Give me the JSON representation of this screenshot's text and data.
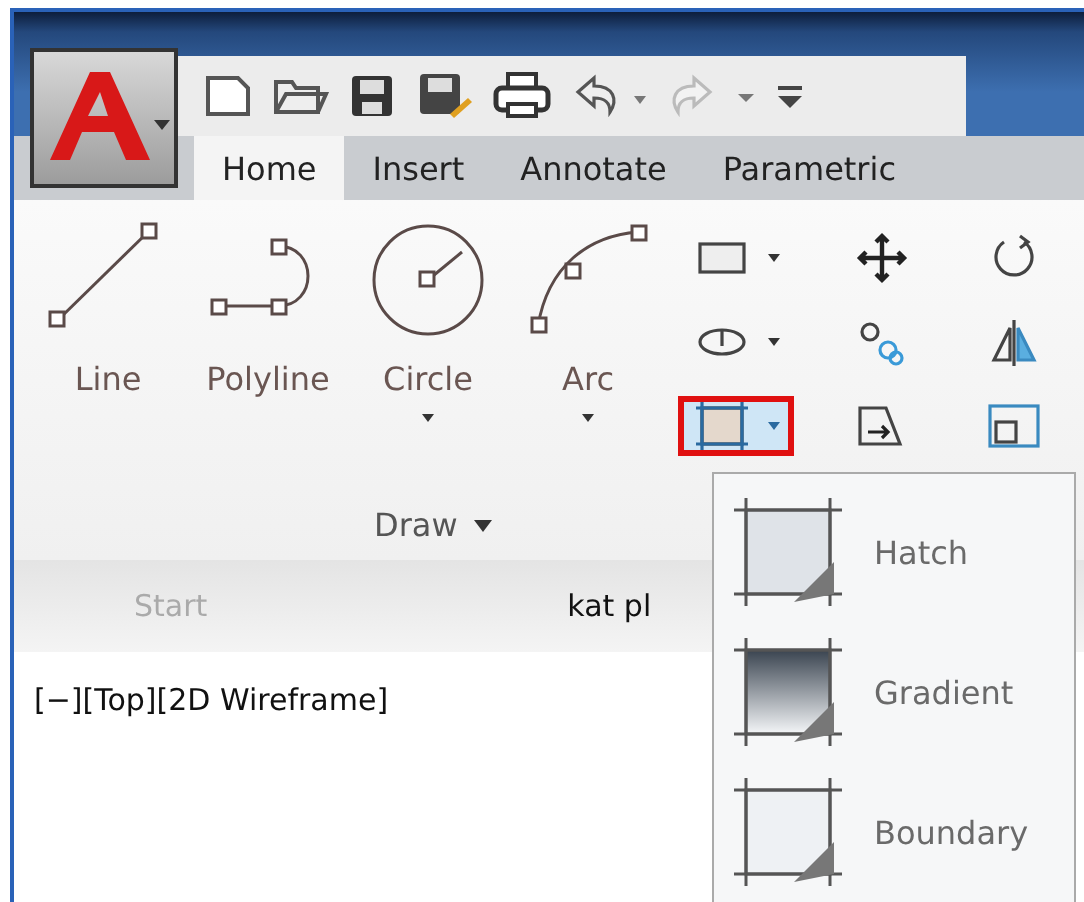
{
  "tabs": [
    {
      "label": "Home",
      "selected": true
    },
    {
      "label": "Insert",
      "selected": false
    },
    {
      "label": "Annotate",
      "selected": false
    },
    {
      "label": "Parametric",
      "selected": false
    }
  ],
  "draw_tools": [
    {
      "kind": "line",
      "label": "Line",
      "dropdown": false
    },
    {
      "kind": "polyline",
      "label": "Polyline",
      "dropdown": false
    },
    {
      "kind": "circle",
      "label": "Circle",
      "dropdown": true
    },
    {
      "kind": "arc",
      "label": "Arc",
      "dropdown": true
    }
  ],
  "small_tools": [
    {
      "kind": "rectangle",
      "dropdown": true,
      "highlighted": false
    },
    {
      "kind": "ellipse",
      "dropdown": true,
      "highlighted": false
    },
    {
      "kind": "hatch",
      "dropdown": true,
      "highlighted": true
    },
    {
      "kind": "move",
      "dropdown": false,
      "highlighted": false
    },
    {
      "kind": "copy",
      "dropdown": false,
      "highlighted": false
    },
    {
      "kind": "stretch",
      "dropdown": false,
      "highlighted": false
    },
    {
      "kind": "rotate",
      "dropdown": false,
      "highlighted": false
    },
    {
      "kind": "mirror",
      "dropdown": false,
      "highlighted": false
    },
    {
      "kind": "scale",
      "dropdown": false,
      "highlighted": false
    }
  ],
  "panel_title": "Draw",
  "file_tabs": [
    {
      "label": "Start",
      "selected": false
    },
    {
      "label": "kat pl",
      "selected": true
    }
  ],
  "viewport_label": "[−][Top][2D Wireframe]",
  "hatch_menu": [
    {
      "kind": "hatch",
      "label": "Hatch"
    },
    {
      "kind": "gradient",
      "label": "Gradient"
    },
    {
      "kind": "boundary",
      "label": "Boundary"
    }
  ]
}
